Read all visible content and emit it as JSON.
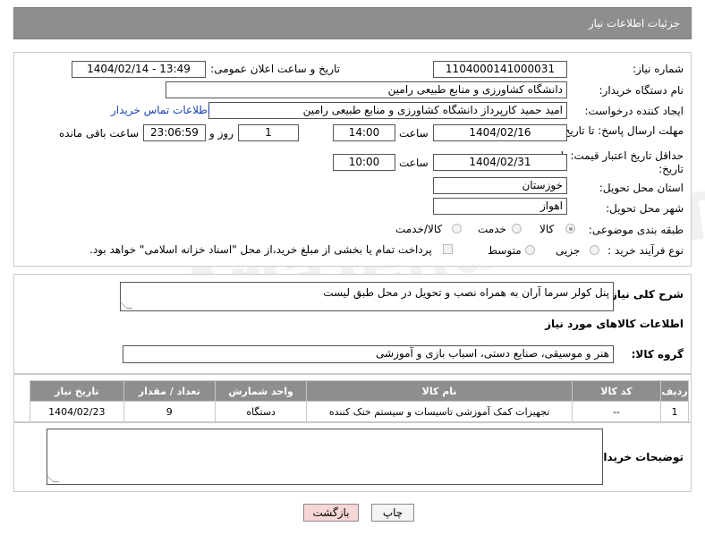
{
  "header": {
    "title": "جزئیات اطلاعات نیاز"
  },
  "form": {
    "need_number_label": "شماره نیاز:",
    "need_number": "1104000141000031",
    "announce_label": "تاریخ و ساعت اعلان عمومی:",
    "announce_value": "1404/02/14 - 13:49",
    "buyer_org_label": "نام دستگاه خریدار:",
    "buyer_org": "دانشگاه کشاورزی و منابع طبیعی رامین",
    "creator_label": "ایجاد کننده درخواست:",
    "creator": "امید حمید کارپرداز دانشگاه کشاورزی و منابع طبیعی رامین",
    "contact_link": "اطلاعات تماس خریدار",
    "reply_deadline_label": "مهلت ارسال پاسخ: تا تاریخ:",
    "reply_date": "1404/02/16",
    "hour_label": "ساعت",
    "reply_time": "14:00",
    "days_value": "1",
    "day_and_label": "روز و",
    "remaining_time": "23:06:59",
    "remaining_label": "ساعت باقی مانده",
    "price_validity_label": "حداقل تاریخ اعتبار قیمت: تا تاریخ:",
    "validity_date": "1404/02/31",
    "hour_label2": "ساعت",
    "validity_time": "10:00",
    "province_label": "استان محل تحویل:",
    "province": "خوزستان",
    "city_label": "شهر محل تحویل:",
    "city": "اهواز",
    "category_label": "طبقه بندی موضوعی:",
    "category_options": [
      "کالا",
      "خدمت",
      "کالا/خدمت"
    ],
    "purchase_type_label": "نوع فرآیند خرید :",
    "purchase_options": [
      "جزیی",
      "متوسط"
    ],
    "payment_note": "پرداخت تمام یا بخشی از مبلغ خرید،از محل \"اسناد خزانه اسلامی\" خواهد بود."
  },
  "description": {
    "label": "شرح کلی نیاز:",
    "value": "پنل کولر سرما آران به همراه نصب و تحویل در محل طبق لیست"
  },
  "goods_section": {
    "title": "اطلاعات کالاهای مورد نیاز",
    "group_label": "گروه کالا:",
    "group_value": "هنر و موسیقی، صنایع دستی، اسباب بازی و آموزشی"
  },
  "table": {
    "headers": [
      "ردیف",
      "کد کالا",
      "نام کالا",
      "واحد شمارش",
      "تعداد / مقدار",
      "تاریخ نیاز"
    ],
    "rows": [
      [
        "1",
        "--",
        "تجهیزات کمک آموزشی تاسیسات و سیستم خنک کننده",
        "دستگاه",
        "9",
        "1404/02/23"
      ]
    ]
  },
  "buyer_notes": {
    "label": "توضیحات خریدار:",
    "value": ""
  },
  "buttons": {
    "print": "چاپ",
    "back": "بازگشت"
  },
  "watermark": {
    "text": "AriaTender.neT"
  },
  "colors": {
    "header_bg": "#8e8e8e",
    "link": "#1a44b0",
    "back_button_bg": "#f6d6d6"
  }
}
